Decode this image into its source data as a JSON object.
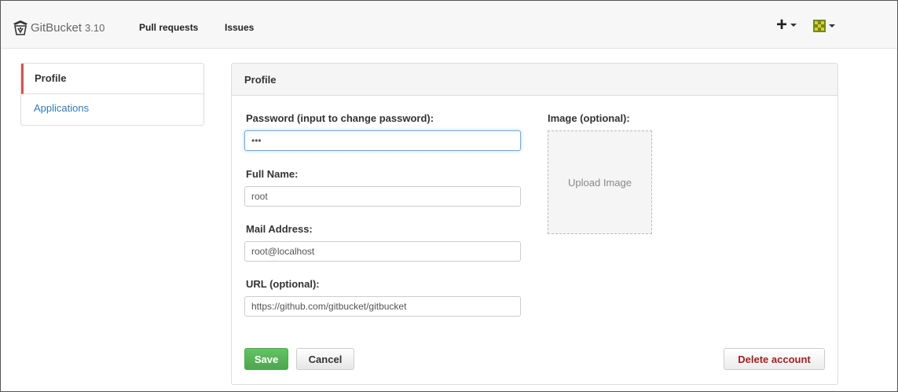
{
  "header": {
    "brand_name": "GitBucket",
    "brand_version": "3.10",
    "nav_pull_requests": "Pull requests",
    "nav_issues": "Issues",
    "plus_label": "+"
  },
  "sidebar": {
    "items": [
      {
        "label": "Profile"
      },
      {
        "label": "Applications"
      }
    ]
  },
  "panel": {
    "title": "Profile",
    "password_label": "Password (input to change password):",
    "password_value": "•••",
    "fullname_label": "Full Name:",
    "fullname_value": "root",
    "mail_label": "Mail Address:",
    "mail_value": "root@localhost",
    "url_label": "URL (optional):",
    "url_value": "https://github.com/gitbucket/gitbucket",
    "image_label": "Image (optional):",
    "upload_label": "Upload Image",
    "save_label": "Save",
    "cancel_label": "Cancel",
    "delete_label": "Delete account"
  },
  "colors": {
    "accent": "#d9534f",
    "link": "#337ab7",
    "save": "#5cb85c",
    "delete_text": "#a0201e"
  },
  "icons": {
    "brand": "gitbucket-logo-icon",
    "plus": "plus-icon",
    "avatar": "avatar-icon"
  }
}
